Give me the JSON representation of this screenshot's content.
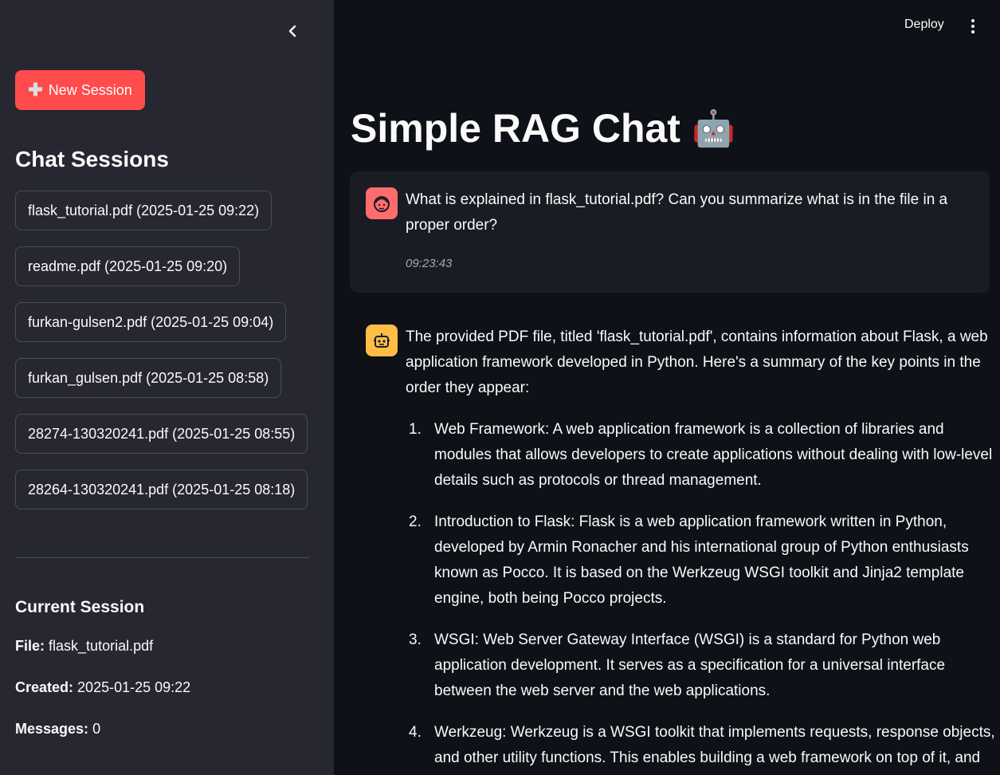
{
  "sidebar": {
    "new_session_label": "New Session",
    "sessions_heading": "Chat Sessions",
    "sessions": [
      "flask_tutorial.pdf (2025-01-25 09:22)",
      "readme.pdf (2025-01-25 09:20)",
      "furkan-gulsen2.pdf (2025-01-25 09:04)",
      "furkan_gulsen.pdf (2025-01-25 08:58)",
      "28274-130320241.pdf (2025-01-25 08:55)",
      "28264-130320241.pdf (2025-01-25 08:18)"
    ],
    "current_heading": "Current Session",
    "file_label": "File:",
    "file_value": "flask_tutorial.pdf",
    "created_label": "Created:",
    "created_value": "2025-01-25 09:22",
    "messages_label": "Messages:",
    "messages_value": "0"
  },
  "header": {
    "deploy_label": "Deploy"
  },
  "main": {
    "title": "Simple RAG Chat",
    "title_emoji": "🤖",
    "user_message": {
      "text": "What is explained in flask_tutorial.pdf? Can you summarize what is in the file in a proper order?",
      "time": "09:23:43"
    },
    "bot_message": {
      "intro": "The provided PDF file, titled 'flask_tutorial.pdf', contains information about Flask, a web application framework developed in Python. Here's a summary of the key points in the order they appear:",
      "items": [
        "Web Framework: A web application framework is a collection of libraries and modules that allows developers to create applications without dealing with low-level details such as protocols or thread management.",
        "Introduction to Flask: Flask is a web application framework written in Python, developed by Armin Ronacher and his international group of Python enthusiasts known as Pocco. It is based on the Werkzeug WSGI toolkit and Jinja2 template engine, both being Pocco projects.",
        "WSGI: Web Server Gateway Interface (WSGI) is a standard for Python web application development. It serves as a specification for a universal interface between the web server and the web applications.",
        "Werkzeug: Werkzeug is a WSGI toolkit that implements requests, response objects, and other utility functions. This enables building a web framework on top of it, and"
      ]
    }
  },
  "colors": {
    "sidebar_bg": "#262730",
    "main_bg": "#0e1117",
    "accent": "#ff4b4b",
    "user_avatar": "#ff6c6c",
    "bot_avatar": "#ffbd45"
  }
}
